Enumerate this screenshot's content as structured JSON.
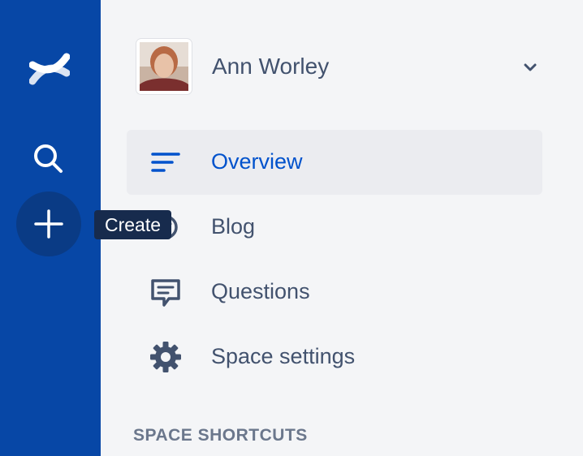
{
  "global_nav": {
    "logo_icon": "confluence-logo",
    "search_icon": "search-icon",
    "create_icon": "plus-icon",
    "tooltip": "Create",
    "colors": {
      "background": "#0747a6",
      "create_button": "#0a3b85",
      "tooltip_bg": "#172b4d"
    }
  },
  "space": {
    "title": "Ann Worley",
    "avatar_icon": "avatar-photo",
    "dropdown_icon": "chevron-down-icon"
  },
  "nav": {
    "items": [
      {
        "label": "Overview",
        "icon": "overview-icon",
        "selected": true
      },
      {
        "label": "Blog",
        "icon": "blog-icon",
        "selected": false
      },
      {
        "label": "Questions",
        "icon": "questions-icon",
        "selected": false
      },
      {
        "label": "Space settings",
        "icon": "gear-icon",
        "selected": false
      }
    ]
  },
  "shortcuts": {
    "heading": "SPACE SHORTCUTS"
  },
  "colors": {
    "selected_text": "#0052cc",
    "text": "#42526e",
    "sidebar_bg": "#f4f5f7"
  }
}
